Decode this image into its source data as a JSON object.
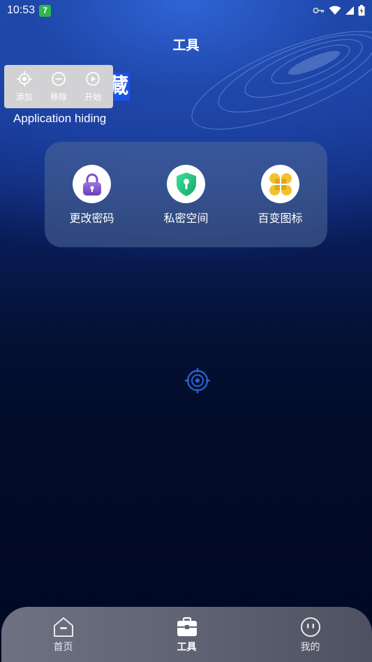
{
  "status_bar": {
    "time": "10:53",
    "badge": "7",
    "icons": [
      "key-icon",
      "wifi-icon",
      "signal-icon",
      "battery-icon"
    ]
  },
  "header": {
    "title": "工具"
  },
  "hidden_app": {
    "title_fragment": "藏",
    "subtitle": "Application hiding"
  },
  "overlay": {
    "items": [
      {
        "label": "添加",
        "icon": "crosshair-icon"
      },
      {
        "label": "移除",
        "icon": "minus-circle-icon"
      },
      {
        "label": "开始",
        "icon": "play-circle-icon"
      }
    ]
  },
  "tools": [
    {
      "label": "更改密码",
      "icon": "lock-icon"
    },
    {
      "label": "私密空间",
      "icon": "shield-key-icon"
    },
    {
      "label": "百变图标",
      "icon": "clover-icon"
    }
  ],
  "bottom_nav": {
    "items": [
      {
        "label": "首页",
        "icon": "home-icon"
      },
      {
        "label": "工具",
        "icon": "toolbox-icon",
        "active": true
      },
      {
        "label": "我的",
        "icon": "face-icon"
      }
    ]
  },
  "colors": {
    "accent": "#1a52e8",
    "shield_green": "#1fc27a",
    "lock_purple": "#7b52c9",
    "clover_yellow": "#f3c22b"
  }
}
